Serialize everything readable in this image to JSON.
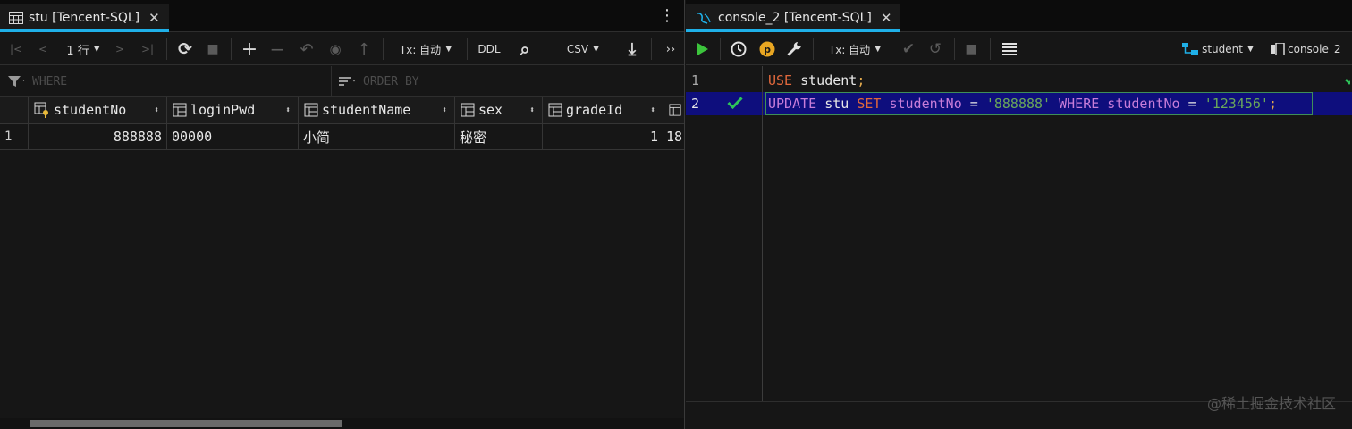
{
  "left": {
    "tab": {
      "title": "stu [Tencent-SQL]",
      "close": "✕"
    },
    "menu": "⋮",
    "toolbar": {
      "first": "|<",
      "prev": "<",
      "rows": "1 行",
      "next": ">",
      "last": ">|",
      "refresh": "⟳",
      "stop": "■",
      "add": "+",
      "remove": "−",
      "revert": "↶",
      "preview": "◉",
      "submit": "↑",
      "tx": "Tx: 自动",
      "ddl": "DDL",
      "search": "⌕",
      "csv": "CSV",
      "download": "⤓",
      "more": "››"
    },
    "filters": {
      "where": "WHERE",
      "order_by": "ORDER BY"
    },
    "columns": [
      {
        "name": "studentNo",
        "key": true
      },
      {
        "name": "loginPwd",
        "key": false
      },
      {
        "name": "studentName",
        "key": false
      },
      {
        "name": "sex",
        "key": false
      },
      {
        "name": "gradeId",
        "key": false
      }
    ],
    "rows": [
      {
        "num": "1",
        "studentNo": "888888",
        "loginPwd": "00000",
        "studentName": "小简",
        "sex": "秘密",
        "gradeId": "1",
        "overflow": "18"
      }
    ]
  },
  "right": {
    "tab": {
      "title": "console_2 [Tencent-SQL]",
      "close": "✕"
    },
    "toolbar": {
      "tx": "Tx: 自动",
      "schema": "student",
      "session": "console_2"
    },
    "lines": [
      {
        "num": "1",
        "tokens": [
          {
            "t": "USE",
            "c": "kw"
          },
          {
            "t": " student",
            "c": "id"
          },
          {
            "t": ";",
            "c": "punc"
          }
        ]
      },
      {
        "num": "2",
        "tokens": [
          {
            "t": "UPDATE",
            "c": "kw2"
          },
          {
            "t": " stu ",
            "c": "id"
          },
          {
            "t": "SET",
            "c": "kw"
          },
          {
            "t": " studentNo",
            "c": "col"
          },
          {
            "t": " = ",
            "c": "id"
          },
          {
            "t": "'888888'",
            "c": "str"
          },
          {
            "t": " WHERE",
            "c": "kw2"
          },
          {
            "t": " studentNo",
            "c": "col"
          },
          {
            "t": " = ",
            "c": "id"
          },
          {
            "t": "'123456'",
            "c": "str"
          },
          {
            "t": ";",
            "c": "punc"
          }
        ]
      }
    ],
    "watermark": "@稀土掘金技术社区"
  },
  "colors": {
    "accent": "#1fb0e8",
    "run": "#3cc43c",
    "ok": "#2ec45a",
    "highlight": "#0e0e7d"
  }
}
